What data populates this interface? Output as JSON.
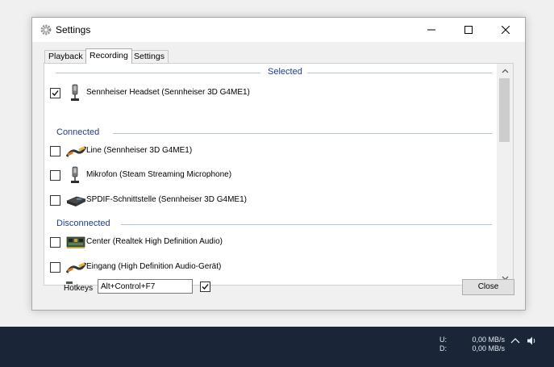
{
  "window": {
    "title": "Settings",
    "tabs": [
      {
        "label": "Playback",
        "active": false
      },
      {
        "label": "Recording",
        "active": true
      },
      {
        "label": "Settings",
        "active": false
      }
    ]
  },
  "groups": {
    "selected": "Selected",
    "connected": "Connected",
    "disconnected": "Disconnected"
  },
  "devices": [
    {
      "label": "Sennheiser Headset (Sennheiser 3D G4ME1)",
      "checked": true,
      "icon": "headset-icon"
    },
    {
      "label": "Line (Sennheiser 3D G4ME1)",
      "checked": false,
      "icon": "line-in-cable-icon"
    },
    {
      "label": "Mikrofon (Steam Streaming Microphone)",
      "checked": false,
      "icon": "microphone-icon"
    },
    {
      "label": "SPDIF-Schnittstelle (Sennheiser 3D G4ME1)",
      "checked": false,
      "icon": "spdif-device-icon"
    },
    {
      "label": "Center (Realtek High Definition Audio)",
      "checked": false,
      "icon": "sound-card-icon"
    },
    {
      "label": "Eingang (High Definition Audio-Gerät)",
      "checked": false,
      "icon": "line-in-cable-icon"
    }
  ],
  "hotkeys": {
    "label": "Hotkeys",
    "value": "Alt+Control+F7",
    "enabled": true
  },
  "close_label": "Close",
  "taskbar": {
    "up_label": "U:",
    "down_label": "D:",
    "up_value": "0,00 MB/s",
    "down_value": "0,00 MB/s"
  },
  "colors": {
    "group_header": "#1f3c8a",
    "taskbar": "#1a2538"
  }
}
